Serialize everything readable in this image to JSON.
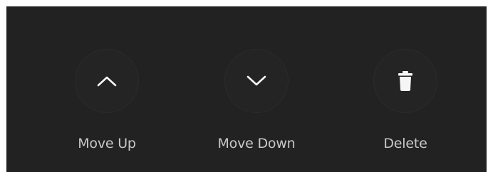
{
  "actions": [
    {
      "id": "move-up",
      "label": "Move Up",
      "icon": "chevron-up-icon"
    },
    {
      "id": "move-down",
      "label": "Move Down",
      "icon": "chevron-down-icon"
    },
    {
      "id": "delete",
      "label": "Delete",
      "icon": "trash-icon"
    }
  ],
  "colors": {
    "background": "#222222",
    "icon": "#f5f5f5",
    "label": "#c8c8c8"
  }
}
